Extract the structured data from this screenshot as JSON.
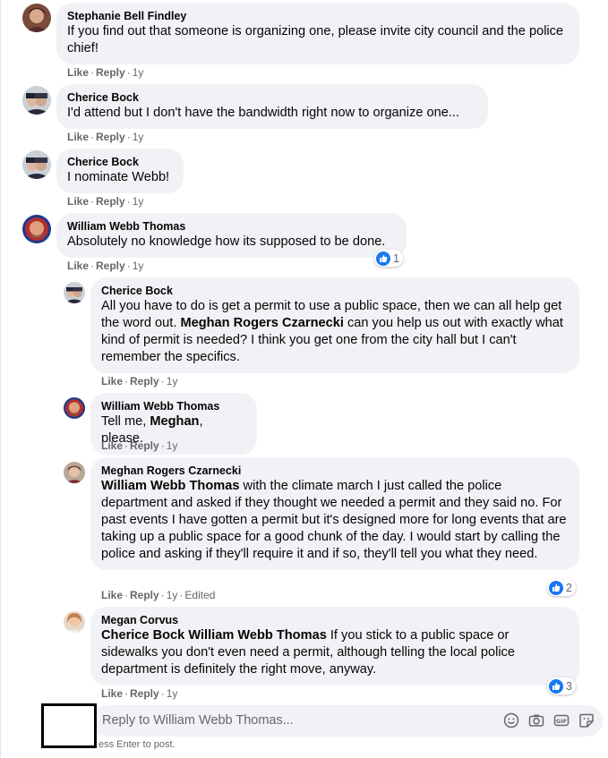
{
  "comments": [
    {
      "author": "Stephanie Bell Findley",
      "text": "If you find out that someone is organizing one, please invite city council and the police chief!",
      "like": "Like",
      "reply": "Reply",
      "time": "1y"
    },
    {
      "author": "Cherice Bock",
      "text": "I'd attend but I don't have the bandwidth right now to organize one...",
      "like": "Like",
      "reply": "Reply",
      "time": "1y"
    },
    {
      "author": "Cherice Bock",
      "text": "I nominate Webb!",
      "like": "Like",
      "reply": "Reply",
      "time": "1y"
    },
    {
      "author": "William Webb Thomas",
      "text": "Absolutely no knowledge how its supposed to be done.",
      "like": "Like",
      "reply": "Reply",
      "time": "1y",
      "reactions": "1"
    }
  ],
  "replies": [
    {
      "author": "Cherice Bock",
      "text_before": "All you have to do is get a permit to use a public space, then we can all help get the word out. ",
      "mention": "Meghan Rogers Czarnecki",
      "text_after": " can you help us out with exactly what kind of permit is needed? I think you get one from the city hall but I can't remember the specifics.",
      "like": "Like",
      "reply": "Reply",
      "time": "1y"
    },
    {
      "author": "William Webb Thomas",
      "text_before": "Tell me, ",
      "mention": "Meghan",
      "text_after": ", please.",
      "like": "Like",
      "reply": "Reply",
      "time": "1y"
    },
    {
      "author": "Meghan Rogers Czarnecki",
      "mention": "William Webb Thomas",
      "text_after": " with the climate march I just called the police department and asked if they thought we needed a permit and they said no. For past events I have gotten a permit but it's designed more for long events that are taking up a public space for a good chunk of the day. I would start by calling the police and asking if they'll require it and if so, they'll tell you what they need.",
      "like": "Like",
      "reply": "Reply",
      "time": "1y",
      "edited": "Edited",
      "reactions": "2"
    },
    {
      "author": "Megan Corvus",
      "mention": "Cherice Bock William Webb Thomas",
      "text_after": " If you stick to a public space or sidewalks you don't even need a permit, although telling the local police department is definitely the right move, anyway.",
      "like": "Like",
      "reply": "Reply",
      "time": "1y",
      "reactions": "3"
    }
  ],
  "reply_box": {
    "placeholder": "Reply to William Webb Thomas...",
    "hint": "ess Enter to post.",
    "tools": [
      "emoji-icon",
      "camera-icon",
      "gif-icon",
      "sticker-icon"
    ]
  },
  "colors": {
    "accent": "#1877f2",
    "bubble": "#f0f2f5",
    "meta": "#65676b"
  }
}
